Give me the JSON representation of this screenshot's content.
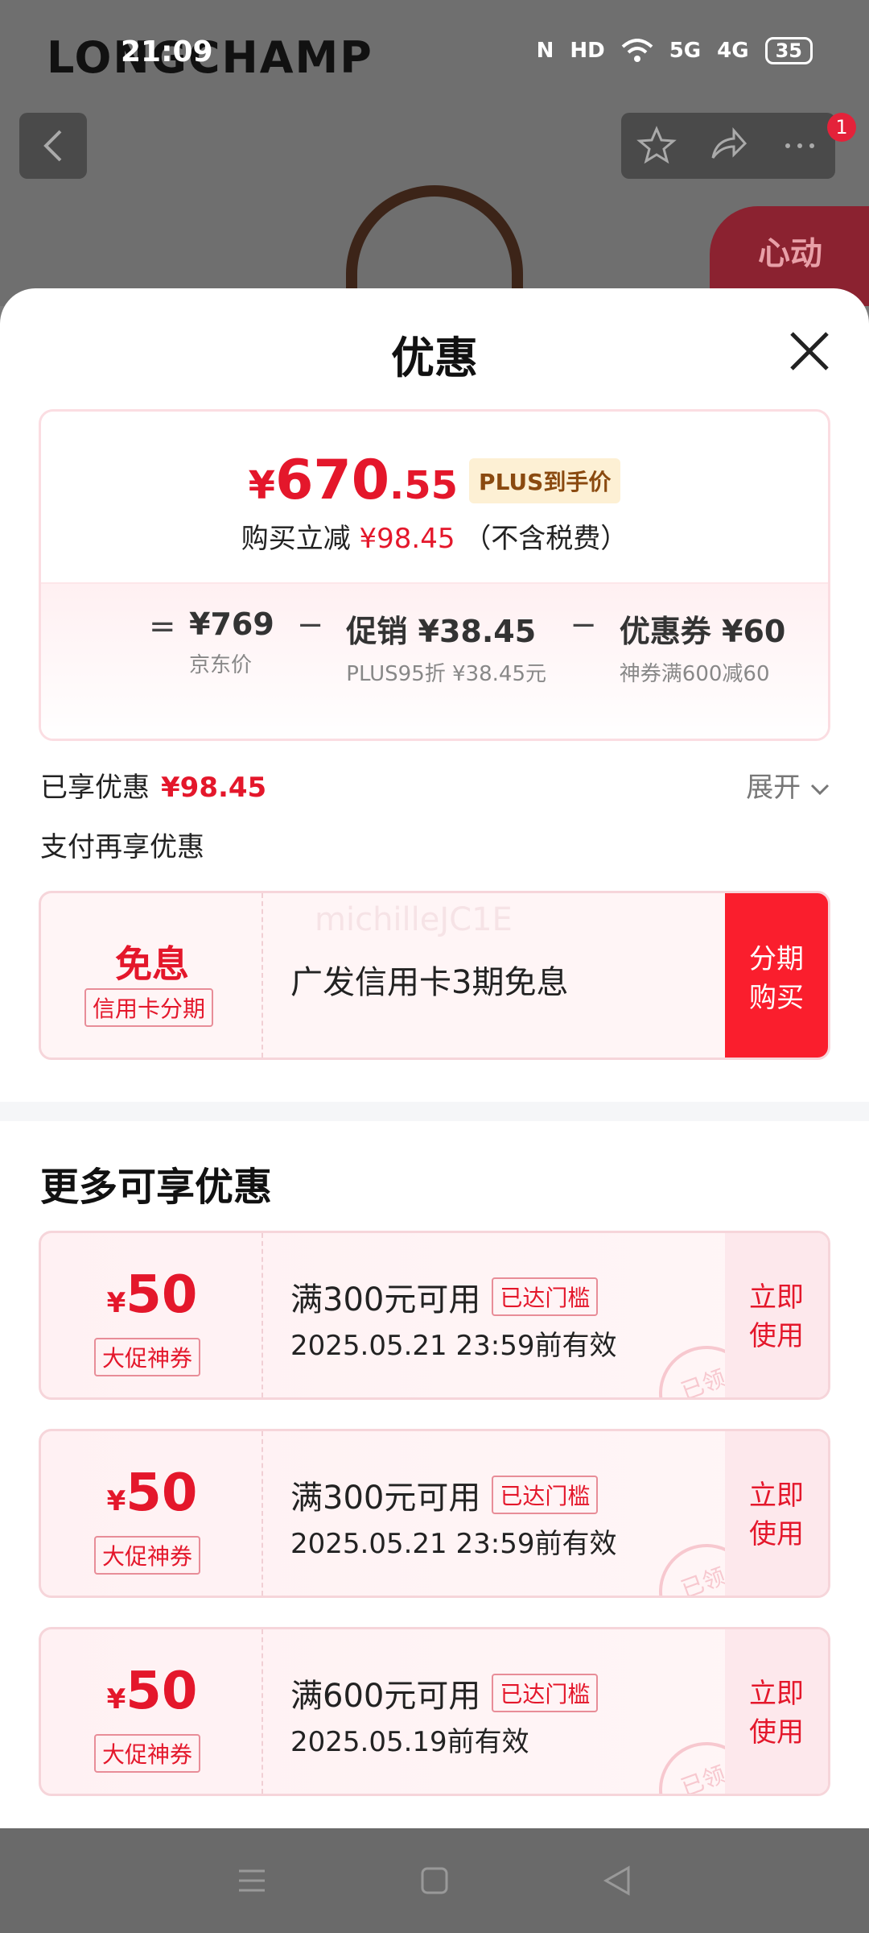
{
  "status_bar": {
    "time": "21:09",
    "network": "5G",
    "network2": "4G",
    "hd": "HD",
    "nfc": "N",
    "battery": "35"
  },
  "background": {
    "brand": "LONGCHAMP",
    "badge_count": "1",
    "promo_text": "心动"
  },
  "sheet": {
    "title": "优惠",
    "price_card": {
      "currency": "¥",
      "price_int": "670",
      "price_dec": ".55",
      "plus_label": "PLUS到手价",
      "sub_prefix": "购买立减",
      "sub_amount": "¥98.45",
      "sub_suffix": "（不含税费）",
      "equals": "=",
      "minus": "−",
      "items": [
        {
          "value": "¥769",
          "caption": "京东价"
        },
        {
          "value": "促销 ¥38.45",
          "caption": "PLUS95折 ¥38.45元"
        },
        {
          "value": "优惠券 ¥60",
          "caption": "神券满600减60"
        }
      ]
    },
    "enjoyed_label": "已享优惠",
    "enjoyed_amount": "¥98.45",
    "expand_label": "展开",
    "pay_more_label": "支付再享优惠",
    "installment": {
      "title": "免息",
      "tag": "信用卡分期",
      "text": "广发信用卡3期免息",
      "button": "分期购买",
      "watermark": "michilleJC1E"
    },
    "more_title": "更多可享优惠",
    "coupons": [
      {
        "currency": "¥",
        "amount": "50",
        "tag": "大促神券",
        "condition": "满300元可用",
        "met": "已达门槛",
        "expiry": "2025.05.21 23:59前有效",
        "button": "立即使用",
        "stamp": "已领"
      },
      {
        "currency": "¥",
        "amount": "50",
        "tag": "大促神券",
        "condition": "满300元可用",
        "met": "已达门槛",
        "expiry": "2025.05.21 23:59前有效",
        "button": "立即使用",
        "stamp": "已领"
      },
      {
        "currency": "¥",
        "amount": "50",
        "tag": "大促神券",
        "condition": "满600元可用",
        "met": "已达门槛",
        "expiry": "2025.05.19前有效",
        "button": "立即使用",
        "stamp": "已领"
      }
    ]
  },
  "nav_icons": [
    "menu-icon",
    "home-icon",
    "back-icon"
  ],
  "colors": {
    "accent": "#e4172b",
    "button": "#fa1e2d"
  }
}
